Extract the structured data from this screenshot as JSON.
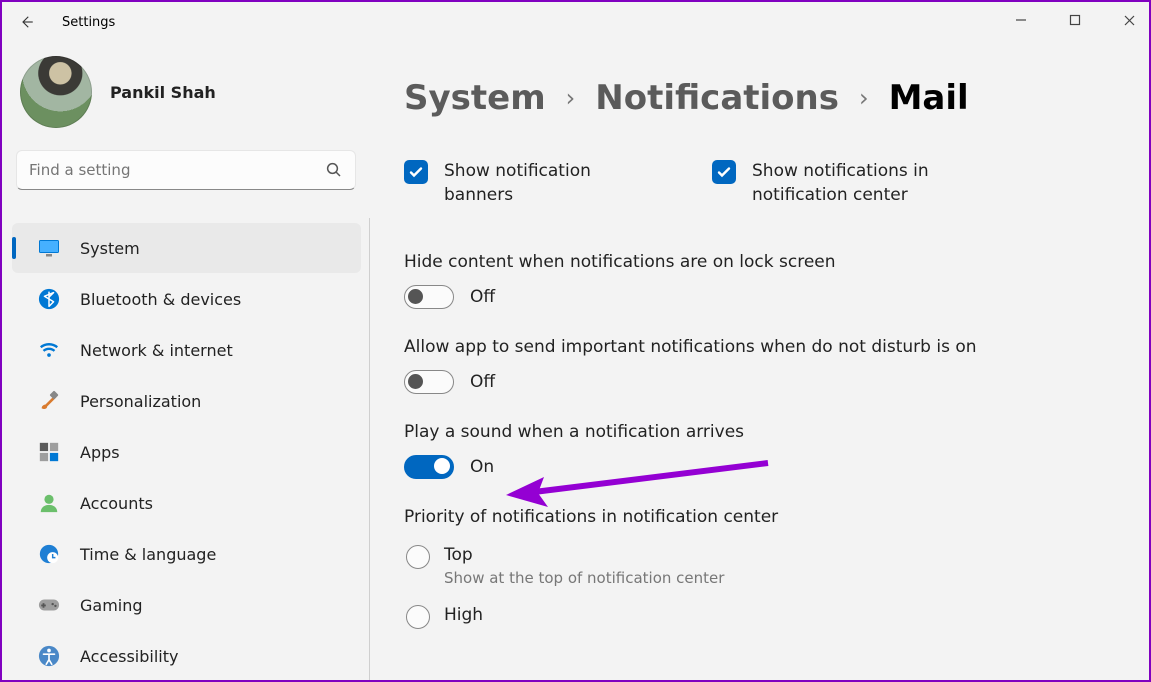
{
  "window": {
    "title": "Settings"
  },
  "user": {
    "name": "Pankil Shah"
  },
  "search": {
    "placeholder": "Find a setting"
  },
  "nav": {
    "items": [
      {
        "label": "System"
      },
      {
        "label": "Bluetooth & devices"
      },
      {
        "label": "Network & internet"
      },
      {
        "label": "Personalization"
      },
      {
        "label": "Apps"
      },
      {
        "label": "Accounts"
      },
      {
        "label": "Time & language"
      },
      {
        "label": "Gaming"
      },
      {
        "label": "Accessibility"
      }
    ],
    "selected_index": 0
  },
  "breadcrumb": {
    "root": "System",
    "mid": "Notifications",
    "leaf": "Mail"
  },
  "checks": {
    "banners": {
      "label": "Show notification banners",
      "checked": true
    },
    "center": {
      "label": "Show notifications in notification center",
      "checked": true
    }
  },
  "toggles": {
    "hide_content": {
      "label": "Hide content when notifications are on lock screen",
      "state": "Off",
      "on": false
    },
    "important_dnd": {
      "label": "Allow app to send important notifications when do not disturb is on",
      "state": "Off",
      "on": false
    },
    "play_sound": {
      "label": "Play a sound when a notification arrives",
      "state": "On",
      "on": true
    }
  },
  "priority": {
    "title": "Priority of notifications in notification center",
    "options": [
      {
        "label": "Top",
        "sub": "Show at the top of notification center"
      },
      {
        "label": "High",
        "sub": ""
      }
    ]
  },
  "colors": {
    "accent": "#0067c0",
    "annotation": "#9400d3"
  }
}
